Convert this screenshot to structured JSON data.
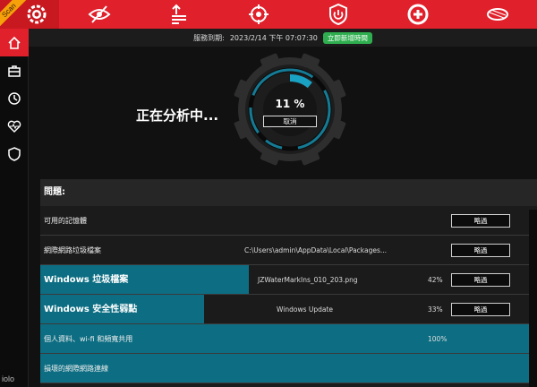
{
  "topbar": {
    "scan_ribbon": "Scan",
    "tabs": [
      {
        "icon": "eye-slash-icon"
      },
      {
        "icon": "upload-arrows-icon"
      },
      {
        "icon": "crosshair-icon"
      },
      {
        "icon": "power-shield-icon"
      },
      {
        "icon": "lifebuoy-plus-icon"
      },
      {
        "icon": "disk-icon"
      }
    ],
    "accent_color": "#e0202b"
  },
  "sidebar": {
    "items": [
      {
        "icon": "home-icon",
        "active": true
      },
      {
        "icon": "toolbox-icon",
        "active": false
      },
      {
        "icon": "clock-icon",
        "active": false
      },
      {
        "icon": "heart-pulse-icon",
        "active": false
      },
      {
        "icon": "shield-icon",
        "active": false
      }
    ],
    "brand": "iolo"
  },
  "status": {
    "expiry_label": "服務到期:",
    "expiry_value": "2023/2/14 下午 07:07:30",
    "renew_button": "立即新增時間"
  },
  "analysis": {
    "title": "正在分析中...",
    "percent": "11 %",
    "progress": 0.11,
    "cancel_button": "取消",
    "ring_color": "#1aa2c4"
  },
  "issues": {
    "header": "問題:",
    "rows": [
      {
        "label": "可用的記憶體",
        "detail": "",
        "percent": "",
        "skip": "略過",
        "progress": 0,
        "bold": false
      },
      {
        "label": "網際網路垃圾檔案",
        "detail": "C:\\Users\\admin\\AppData\\Local\\Packages...",
        "percent": "",
        "skip": "略過",
        "progress": 0,
        "bold": false
      },
      {
        "label": "Windows 垃圾檔案",
        "detail": "JZWaterMarkIns_010_203.png",
        "percent": "42%",
        "skip": "略過",
        "progress": 0.42,
        "bold": true
      },
      {
        "label": "Windows 安全性弱點",
        "detail": "Windows Update",
        "percent": "33%",
        "skip": "略過",
        "progress": 0.33,
        "bold": true
      },
      {
        "label": "個人資料、wi-fi 和頻寬共用",
        "detail": "",
        "percent": "100%",
        "skip": "",
        "progress": 1,
        "bold": false
      },
      {
        "label": "損壞的網際網路連線",
        "detail": "",
        "percent": "",
        "skip": "",
        "progress": 1,
        "bold": false
      }
    ],
    "fill_color": "#0d6e83"
  }
}
